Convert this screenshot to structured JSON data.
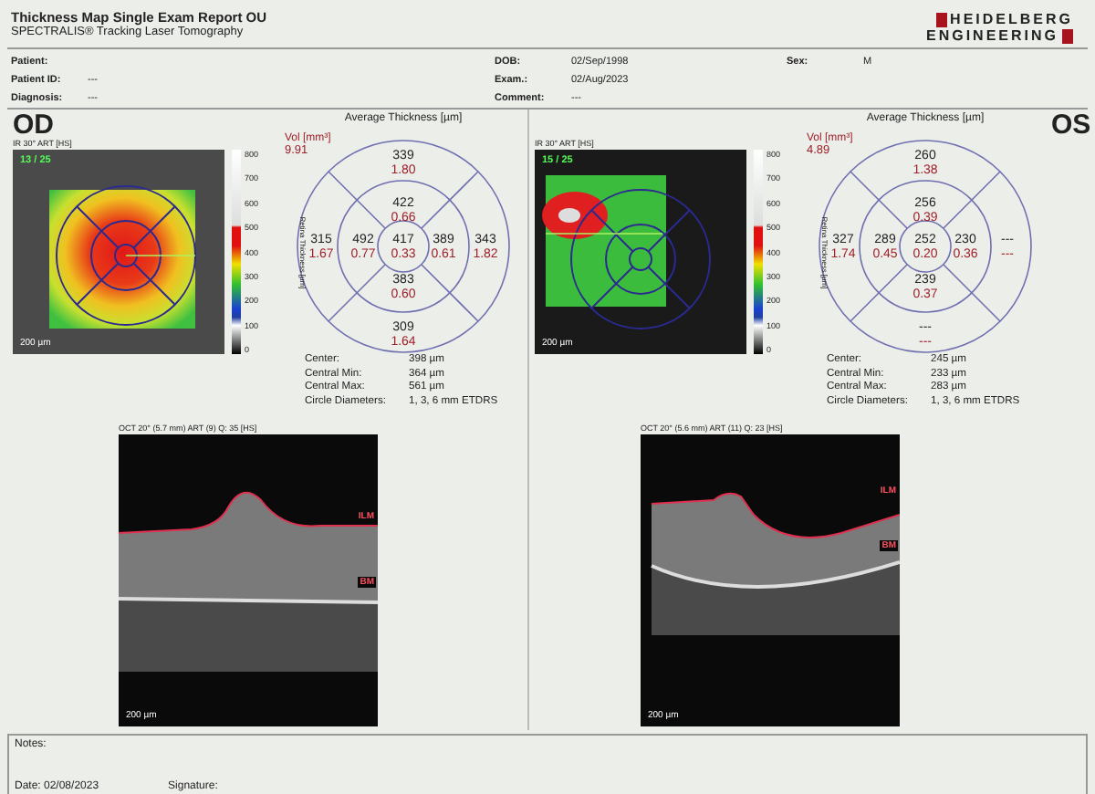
{
  "report": {
    "title": "Thickness Map Single Exam Report OU",
    "subtitle": "SPECTRALIS® Tracking Laser Tomography",
    "logo": [
      "HEIDELBERG",
      "ENGINEERING"
    ]
  },
  "patient_columns": [
    [
      {
        "label": "Patient:"
      },
      {
        "label": "Patient ID:",
        "value": "---"
      },
      {
        "label": "Diagnosis:",
        "value": "---"
      }
    ],
    [
      {
        "label": "DOB:",
        "value": "02/Sep/1998"
      },
      {
        "label": "Exam.:",
        "value": "02/Aug/2023"
      },
      {
        "label": "Comment:",
        "value": "---"
      }
    ],
    [
      {
        "label": "Sex:",
        "value": "M"
      }
    ]
  ],
  "eyes": [
    {
      "label": "OD",
      "fundus": {
        "header": "IR 30° ART [HS]",
        "frames": "13 / 25",
        "scale": "200 µm"
      },
      "colorbar": {
        "title": "Retina Thickness [µm]",
        "ticks": [
          "800",
          "700",
          "600",
          "500",
          "400",
          "300",
          "200",
          "100",
          "0"
        ]
      },
      "grid": {
        "title": "Average Thickness [µm]",
        "volume_label": "Vol [mm³]",
        "volume": "9.91",
        "sectors": [
          {
            "kind": "outer_top",
            "thickness": "339",
            "volume": "1.80"
          },
          {
            "kind": "inner_top",
            "thickness": "422",
            "volume": "0.66"
          },
          {
            "kind": "outer_left",
            "thickness": "315",
            "volume": "1.67"
          },
          {
            "kind": "inner_left",
            "thickness": "492",
            "volume": "0.77"
          },
          {
            "kind": "center",
            "thickness": "417",
            "volume": "0.33"
          },
          {
            "kind": "inner_right",
            "thickness": "389",
            "volume": "0.61"
          },
          {
            "kind": "outer_right",
            "thickness": "343",
            "volume": "1.82"
          },
          {
            "kind": "inner_bottom",
            "thickness": "383",
            "volume": "0.60"
          },
          {
            "kind": "outer_bottom",
            "thickness": "309",
            "volume": "1.64"
          }
        ]
      },
      "stats": [
        {
          "label": "Center:",
          "value": "398 µm"
        },
        {
          "label": "Central Min:",
          "value": "364 µm"
        },
        {
          "label": "Central Max:",
          "value": "561 µm"
        },
        {
          "label": "Circle Diameters:",
          "value": "1, 3, 6 mm ETDRS"
        }
      ],
      "oct": {
        "header": "OCT 20° (5.7 mm) ART (9) Q: 35 [HS]",
        "scale": "200 µm",
        "layers": [
          "ILM",
          "BM"
        ]
      }
    },
    {
      "label": "OS",
      "fundus": {
        "header": "IR 30° ART [HS]",
        "frames": "15 / 25",
        "scale": "200 µm"
      },
      "colorbar": {
        "title": "Retina Thickness [µm]",
        "ticks": [
          "800",
          "700",
          "600",
          "500",
          "400",
          "300",
          "200",
          "100",
          "0"
        ]
      },
      "grid": {
        "title": "Average Thickness [µm]",
        "volume_label": "Vol [mm³]",
        "volume": "4.89",
        "sectors": [
          {
            "kind": "outer_top",
            "thickness": "260",
            "volume": "1.38"
          },
          {
            "kind": "inner_top",
            "thickness": "256",
            "volume": "0.39"
          },
          {
            "kind": "outer_left",
            "thickness": "327",
            "volume": "1.74"
          },
          {
            "kind": "inner_left",
            "thickness": "289",
            "volume": "0.45"
          },
          {
            "kind": "center",
            "thickness": "252",
            "volume": "0.20"
          },
          {
            "kind": "inner_right",
            "thickness": "230",
            "volume": "0.36"
          },
          {
            "kind": "outer_right",
            "thickness": "---",
            "volume": "---"
          },
          {
            "kind": "inner_bottom",
            "thickness": "239",
            "volume": "0.37"
          },
          {
            "kind": "outer_bottom",
            "thickness": "---",
            "volume": "---"
          }
        ]
      },
      "stats": [
        {
          "label": "Center:",
          "value": "245 µm"
        },
        {
          "label": "Central Min:",
          "value": "233 µm"
        },
        {
          "label": "Central Max:",
          "value": "283 µm"
        },
        {
          "label": "Circle Diameters:",
          "value": "1, 3, 6 mm ETDRS"
        }
      ],
      "oct": {
        "header": "OCT 20° (5.6 mm) ART (11) Q: 23 [HS]",
        "scale": "200 µm",
        "layers": [
          "ILM",
          "BM"
        ]
      }
    }
  ],
  "footer": {
    "notes_label": "Notes:",
    "date": "Date: 02/08/2023",
    "signature_label": "Signature:"
  }
}
